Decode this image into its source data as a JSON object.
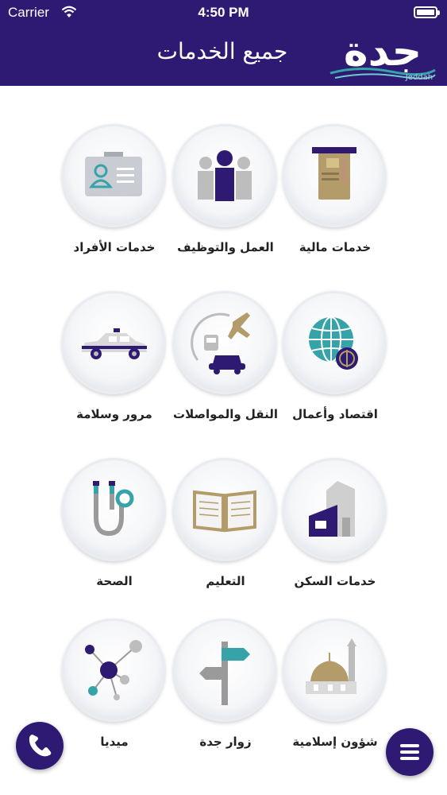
{
  "status_bar": {
    "carrier": "Carrier",
    "time": "4:50 PM"
  },
  "header": {
    "title": "جميع الخدمات",
    "logo_text": "جدة",
    "logo_subtext": "Jeddah"
  },
  "services": [
    {
      "label": "خدمات مالية",
      "icon": "atm-card-icon"
    },
    {
      "label": "العمل والتوظيف",
      "icon": "people-icon"
    },
    {
      "label": "خدمات الأفراد",
      "icon": "id-card-icon"
    },
    {
      "label": "اقتصاد وأعمال",
      "icon": "globe-currency-icon"
    },
    {
      "label": "النقل والمواصلات",
      "icon": "transport-icon"
    },
    {
      "label": "مرور وسلامة",
      "icon": "police-car-icon"
    },
    {
      "label": "خدمات السكن",
      "icon": "house-icon"
    },
    {
      "label": "التعليم",
      "icon": "book-icon"
    },
    {
      "label": "الصحة",
      "icon": "stethoscope-icon"
    },
    {
      "label": "شؤون إسلامية",
      "icon": "mosque-icon"
    },
    {
      "label": "زوار جدة",
      "icon": "signpost-icon"
    },
    {
      "label": "ميديا",
      "icon": "network-icon"
    }
  ],
  "colors": {
    "primary": "#2e1a73",
    "accent_teal": "#35a3a8",
    "gray": "#b9b9b9",
    "gold": "#b39c69"
  },
  "fabs": {
    "call": "phone-icon",
    "menu": "hamburger-menu-icon"
  }
}
